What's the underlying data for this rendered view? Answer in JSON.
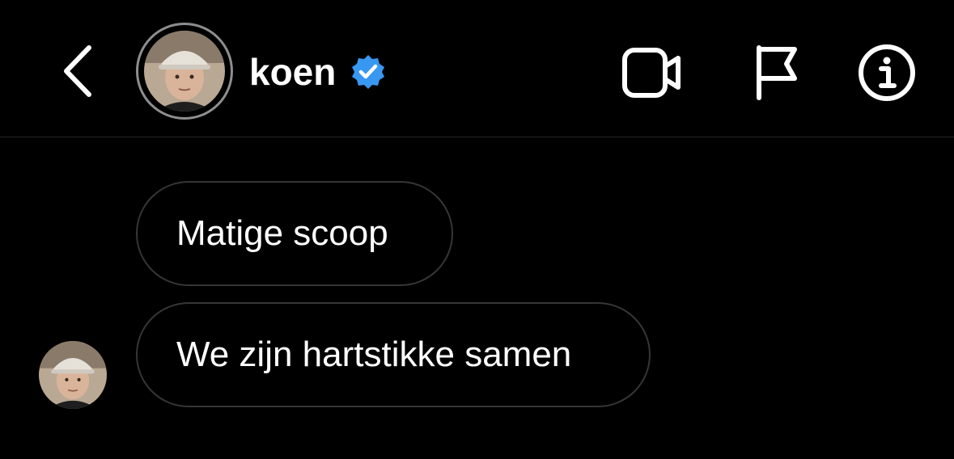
{
  "header": {
    "username": "koen",
    "verified": true,
    "icons": {
      "back": "chevron-left-icon",
      "verified": "verified-badge-icon",
      "video": "video-camera-icon",
      "flag": "flag-icon",
      "info": "info-icon"
    }
  },
  "messages": [
    {
      "text": "Matige scoop"
    },
    {
      "text": "We zijn hartstikke samen"
    }
  ],
  "colors": {
    "background": "#000000",
    "text": "#ffffff",
    "verified_blue": "#3897f0",
    "bubble_border": "#363636",
    "divider": "#262626"
  }
}
